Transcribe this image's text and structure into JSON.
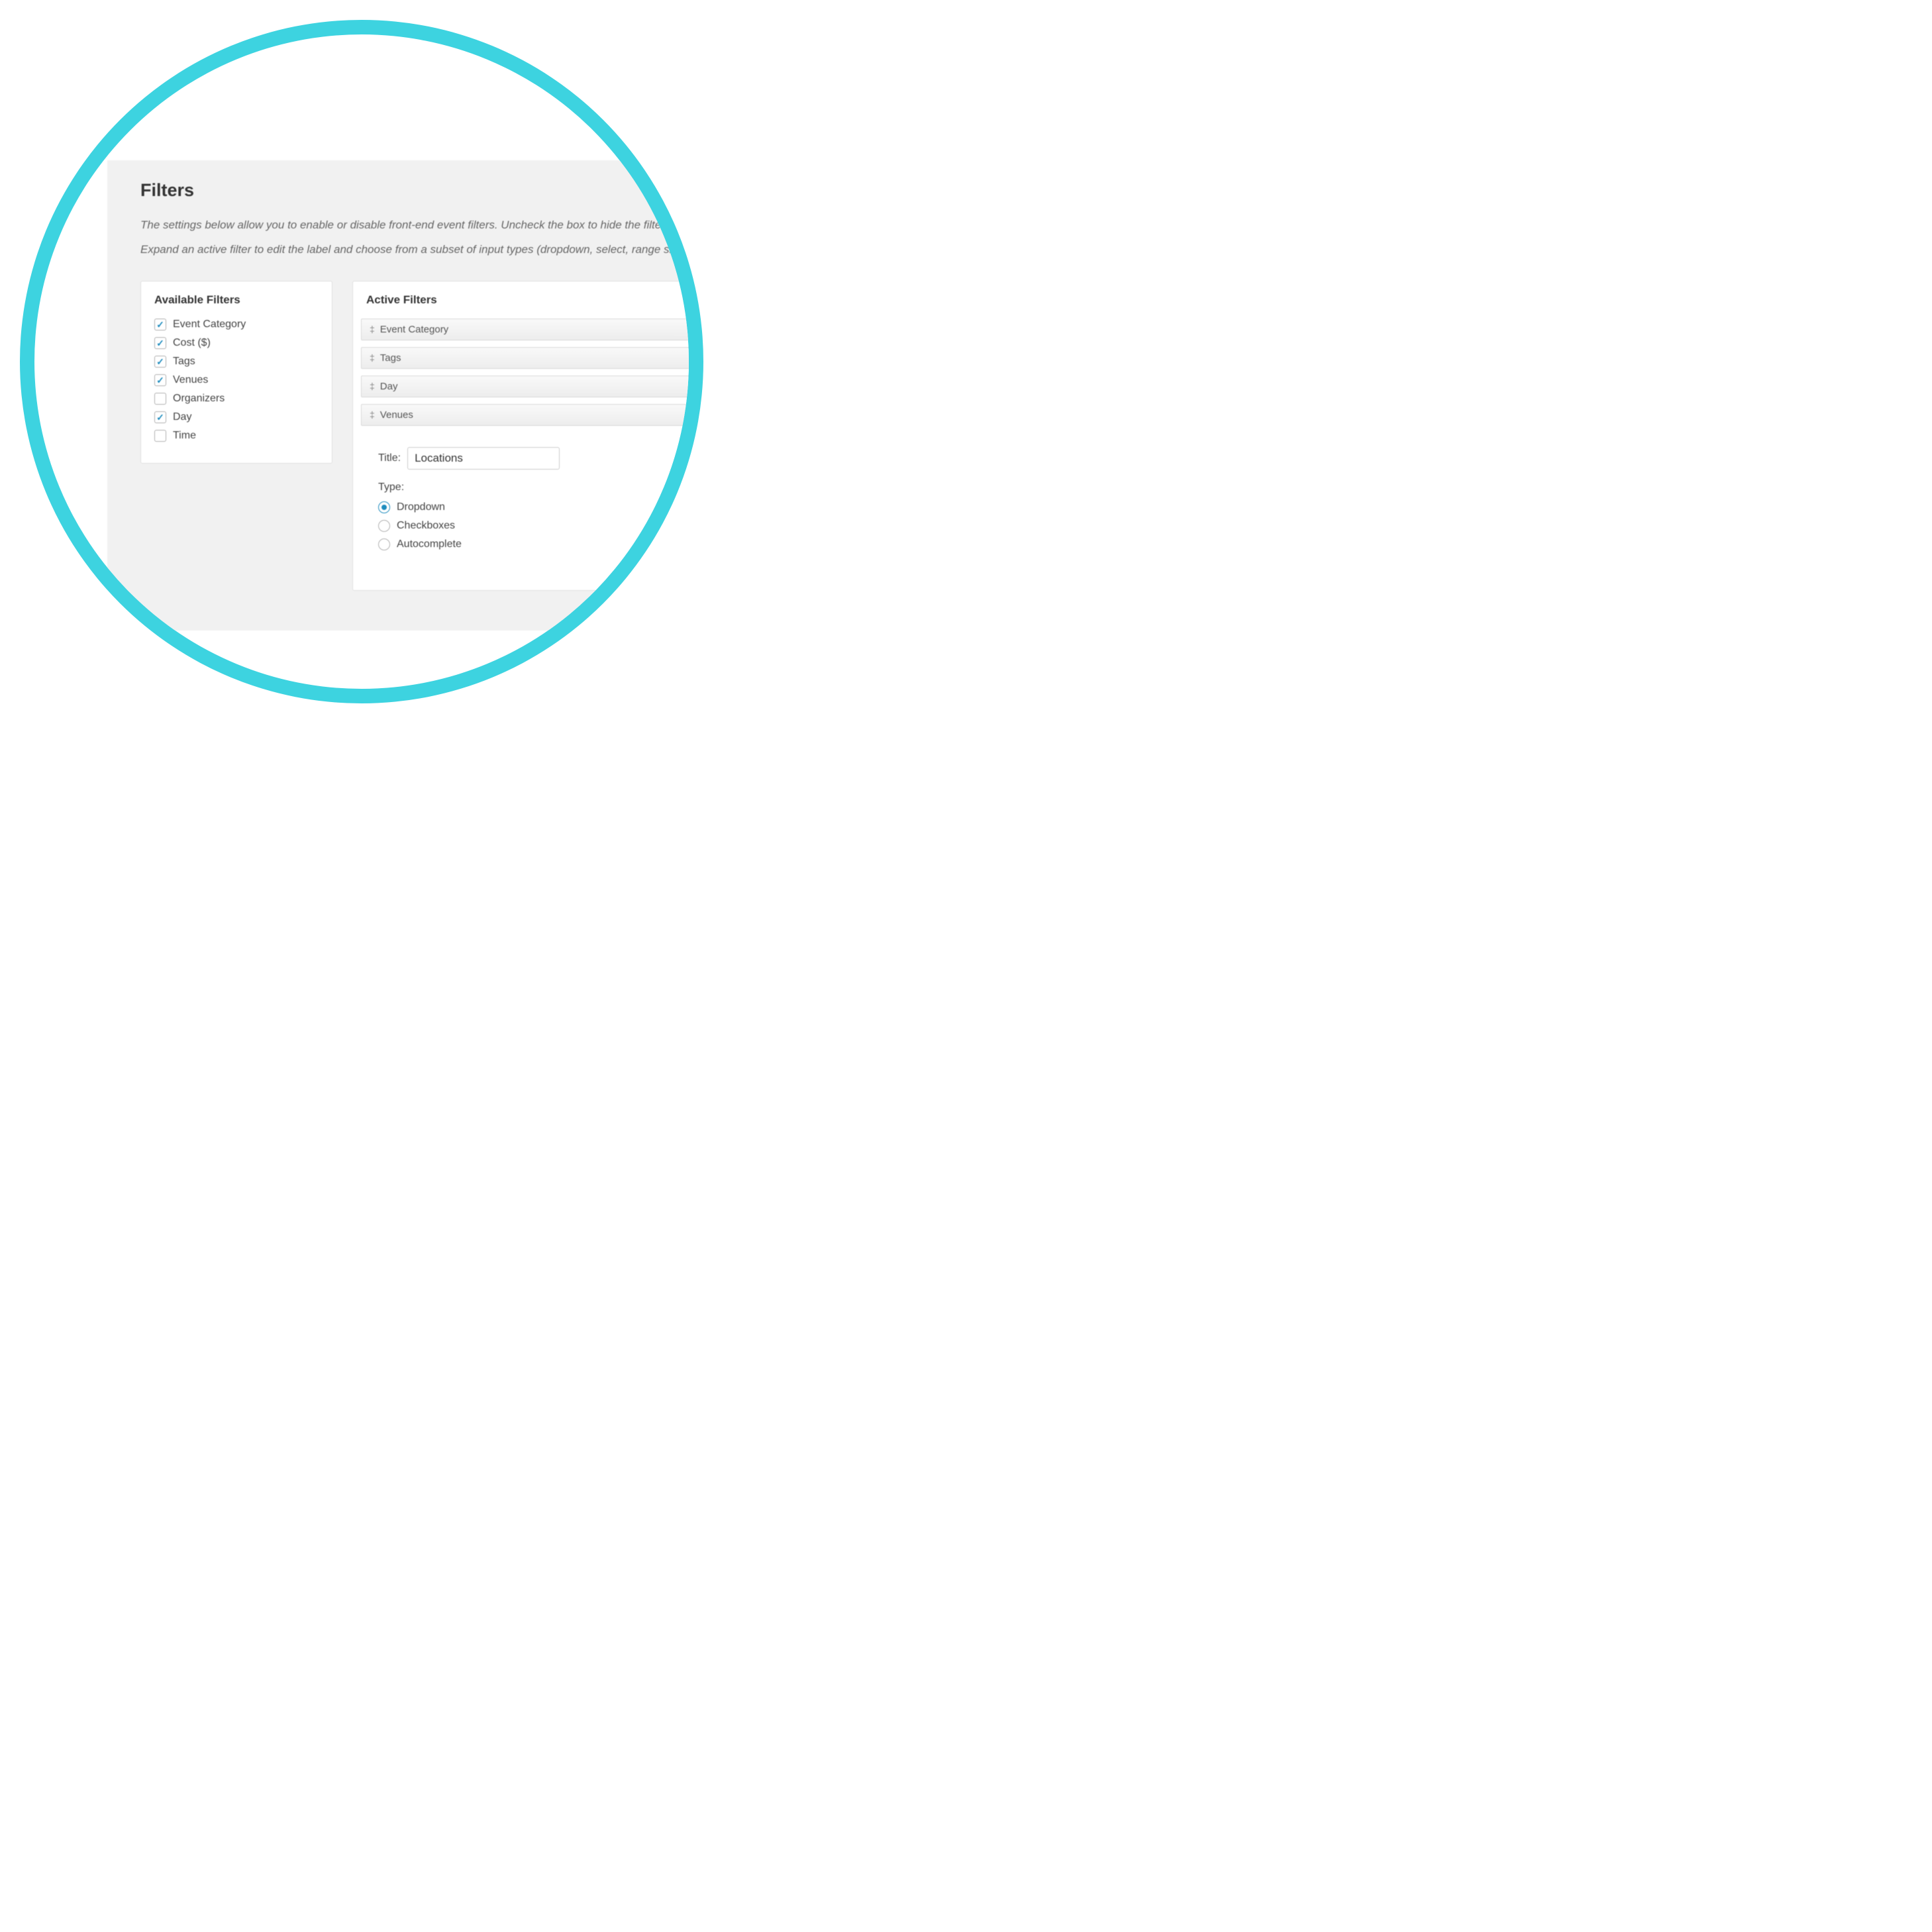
{
  "page": {
    "title": "Filters",
    "description_line1": "The settings below allow you to enable or disable front-end event filters. Uncheck the box to hide the filter. Drag and",
    "description_line2": "Expand an active filter to edit the label and choose from a subset of input types (dropdown, select, range slider, checkb"
  },
  "available": {
    "title": "Available Filters",
    "items": [
      {
        "label": "Event Category",
        "checked": true
      },
      {
        "label": "Cost ($)",
        "checked": true
      },
      {
        "label": "Tags",
        "checked": true
      },
      {
        "label": "Venues",
        "checked": true
      },
      {
        "label": "Organizers",
        "checked": false
      },
      {
        "label": "Day",
        "checked": true
      },
      {
        "label": "Time",
        "checked": false
      }
    ]
  },
  "active": {
    "title": "Active Filters",
    "items": [
      {
        "label": "Event Category"
      },
      {
        "label": "Tags"
      },
      {
        "label": "Day"
      },
      {
        "label": "Venues"
      }
    ],
    "expanded": {
      "title_label": "Title:",
      "title_value": "Locations",
      "type_label": "Type:",
      "options": [
        {
          "label": "Dropdown",
          "selected": true
        },
        {
          "label": "Checkboxes",
          "selected": false
        },
        {
          "label": "Autocomplete",
          "selected": false
        }
      ]
    }
  }
}
